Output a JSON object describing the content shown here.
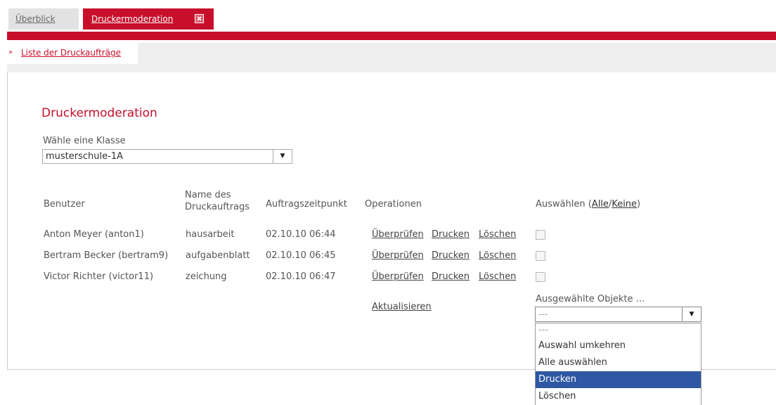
{
  "tabs": [
    {
      "label": "Überblick"
    },
    {
      "label": "Druckermoderation"
    }
  ],
  "breadcrumb": {
    "label": "Liste der Druckaufträge"
  },
  "page": {
    "title": "Druckermoderation",
    "class_label": "Wähle eine Klasse",
    "class_value": "musterschule-1A"
  },
  "table": {
    "headers": {
      "user": "Benutzer",
      "jobname_1": "Name des",
      "jobname_2": "Druckauftrags",
      "time": "Auftragszeitpunkt",
      "ops": "Operationen",
      "select_prefix": "Auswählen (",
      "select_all": "Alle",
      "select_sep": "/",
      "select_none": "Keine",
      "select_suffix": ")"
    },
    "rows": [
      {
        "user": "Anton Meyer (anton1)",
        "job": "hausarbeit",
        "time": "02.10.10 06:44",
        "check": "Überprüfen",
        "print": "Drucken",
        "delete": "Löschen",
        "selected": false
      },
      {
        "user": "Bertram Becker (bertram9)",
        "job": "aufgabenblatt",
        "time": "02.10.10 06:45",
        "check": "Überprüfen",
        "print": "Drucken",
        "delete": "Löschen",
        "selected": false
      },
      {
        "user": "Victor Richter (victor11)",
        "job": "zeichung",
        "time": "02.10.10 06:47",
        "check": "Überprüfen",
        "print": "Drucken",
        "delete": "Löschen",
        "selected": false
      }
    ]
  },
  "refresh_label": "Aktualisieren",
  "bulk": {
    "label": "Ausgewählte Objekte ...",
    "value": "---",
    "options": [
      "---",
      "Auswahl umkehren",
      "Alle auswählen",
      "Drucken",
      "Löschen"
    ],
    "highlighted": "Drucken"
  },
  "colors": {
    "accent": "#c70f2b",
    "highlight": "#2f57a3"
  },
  "icons": {
    "tab_close": "close-icon",
    "breadcrumb_arrow": "double-chevron-right-icon",
    "select_arrow": "triangle-down-icon"
  }
}
